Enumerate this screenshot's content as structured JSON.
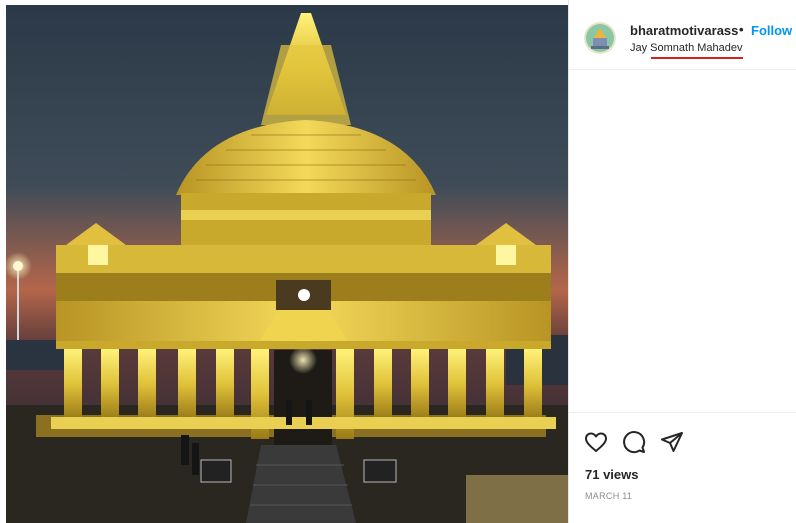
{
  "post": {
    "username": "bharatmotivarass",
    "separator": "•",
    "follow_label": "Follow",
    "location": "Jay Somnath Mahadev",
    "views": "71 views",
    "date": "MARCH 11"
  },
  "icons": {
    "like": "heart-icon",
    "comment": "comment-icon",
    "share": "paper-plane-icon"
  },
  "colors": {
    "follow": "#0095f6",
    "annotation_underline": "#d0231f"
  }
}
